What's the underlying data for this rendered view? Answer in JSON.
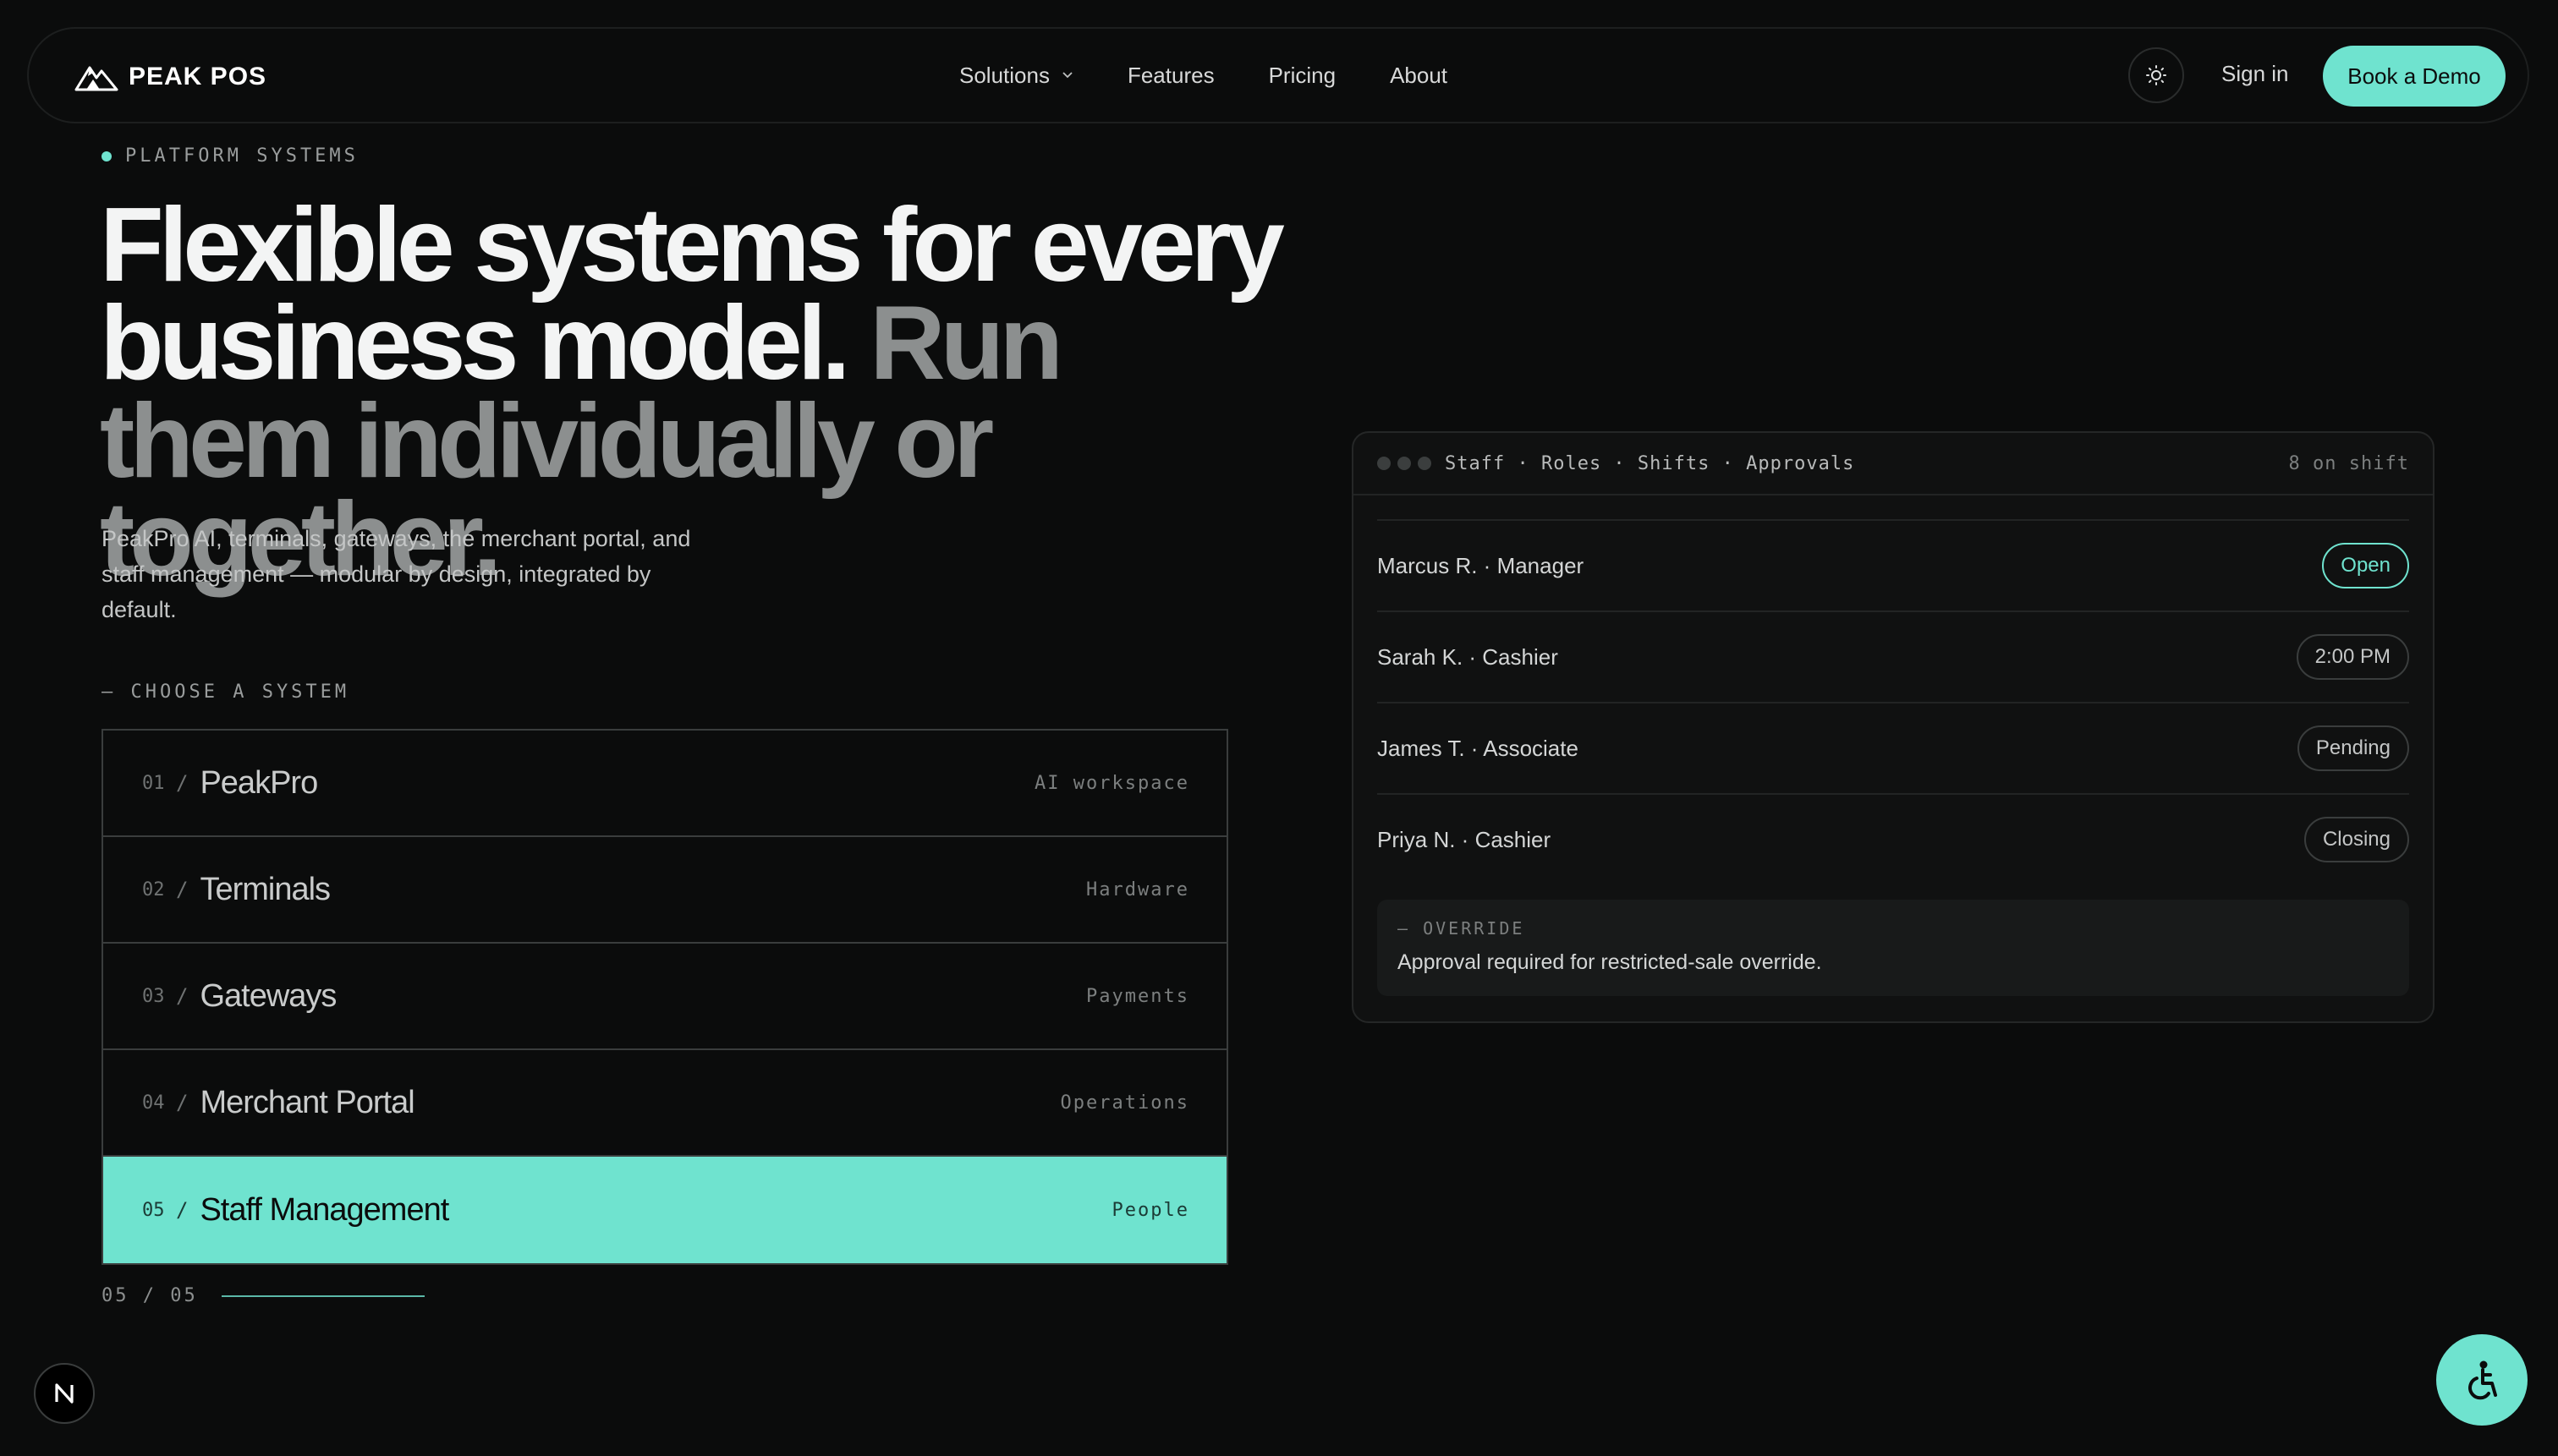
{
  "nav": {
    "brand": "PEAK POS",
    "links": [
      {
        "label": "Solutions",
        "has_dropdown": true
      },
      {
        "label": "Features"
      },
      {
        "label": "Pricing"
      },
      {
        "label": "About"
      }
    ],
    "theme_icon": "sun-icon",
    "sign_in": "Sign in",
    "cta": "Book a Demo"
  },
  "hero": {
    "eyebrow": "PLATFORM SYSTEMS",
    "headline_bright": "Flexible systems for every business model.",
    "headline_dim": "Run them individually or together.",
    "subtitle": "PeakPro AI, terminals, gateways, the merchant portal, and staff management — modular by design, integrated by default.",
    "choose_label": "— CHOOSE A SYSTEM"
  },
  "systems": [
    {
      "num": "01",
      "name": "PeakPro",
      "tag": "AI workspace",
      "active": false
    },
    {
      "num": "02",
      "name": "Terminals",
      "tag": "Hardware",
      "active": false
    },
    {
      "num": "03",
      "name": "Gateways",
      "tag": "Payments",
      "active": false
    },
    {
      "num": "04",
      "name": "Merchant Portal",
      "tag": "Operations",
      "active": false
    },
    {
      "num": "05",
      "name": "Staff Management",
      "tag": "People",
      "active": true
    }
  ],
  "counter": "05 / 05",
  "panel": {
    "crumbs": "Staff · Roles · Shifts · Approvals",
    "on_shift": "8 on shift",
    "staff": [
      {
        "name": "Marcus R. · Manager",
        "status": "Open"
      },
      {
        "name": "Sarah K. · Cashier",
        "status": "2:00 PM"
      },
      {
        "name": "James T. · Associate",
        "status": "Pending"
      },
      {
        "name": "Priya N. · Cashier",
        "status": "Closing"
      }
    ],
    "override_label": "— OVERRIDE",
    "override_text": "Approval required for restricted-sale override."
  },
  "colors": {
    "accent": "#6fe3cf",
    "background": "#0b0c0c"
  }
}
